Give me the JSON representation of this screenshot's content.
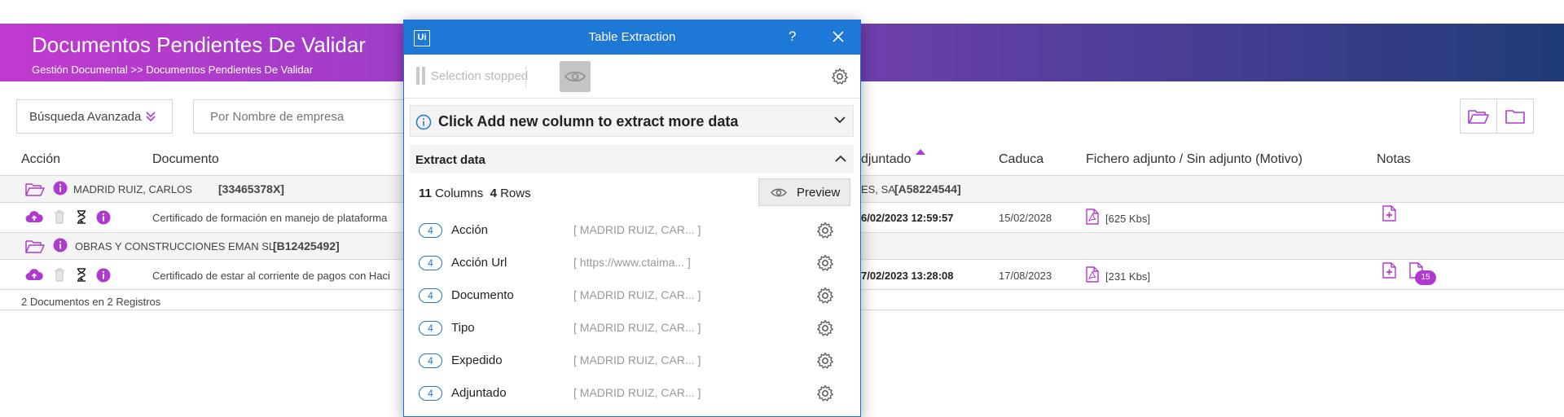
{
  "header": {
    "title": "Documentos Pendientes De Validar",
    "breadcrumb": "Gestión Documental >> Documentos Pendientes De Validar"
  },
  "search": {
    "advanced_label": "Búsqueda Avanzada",
    "company_placeholder": "Por Nombre de empresa"
  },
  "table": {
    "columns": {
      "accion": "Acción",
      "documento": "Documento",
      "adjuntado": "djuntado",
      "caduca": "Caduca",
      "fichero": "Fichero adjunto / Sin adjunto (Motivo)",
      "notas": "Notas"
    },
    "groups": [
      {
        "name": "MADRID RUIZ, CARLOS",
        "id": "[33465378X]",
        "right_name": "ES, SA",
        "right_id": "[A58224544]",
        "doc": "Certificado de formación en manejo de plataforma",
        "adjuntado": "6/02/2023 12:59:57",
        "caduca": "15/02/2028",
        "size": "[625 Kbs]"
      },
      {
        "name": "OBRAS Y CONSTRUCCIONES EMAN SL",
        "id": "[B12425492]",
        "doc": "Certificado de estar al corriente de pagos con Haci",
        "adjuntado": "7/02/2023 13:28:08",
        "caduca": "17/08/2023",
        "size": "[231 Kbs]",
        "notes_count": "15"
      }
    ],
    "footer": "2 Documentos en 2 Registros"
  },
  "dialog": {
    "title": "Table Extraction",
    "help": "?",
    "selection_status": "Selection stopped",
    "info_message": "Click Add new column to extract more data",
    "extract_section": "Extract data",
    "columns_count": "11",
    "columns_label": "Columns",
    "rows_count": "4",
    "rows_label": "Rows",
    "preview_label": "Preview",
    "columns": [
      {
        "count": "4",
        "name": "Acción",
        "preview": "[ MADRID RUIZ, CAR... ]"
      },
      {
        "count": "4",
        "name": "Acción Url",
        "preview": "[ https://www.ctaima... ]"
      },
      {
        "count": "4",
        "name": "Documento",
        "preview": "[ MADRID RUIZ, CAR... ]"
      },
      {
        "count": "4",
        "name": "Tipo",
        "preview": "[ MADRID RUIZ, CAR... ]"
      },
      {
        "count": "4",
        "name": "Expedido",
        "preview": "[ MADRID RUIZ, CAR... ]"
      },
      {
        "count": "4",
        "name": "Adjuntado",
        "preview": "[ MADRID RUIZ, CAR... ]"
      }
    ]
  },
  "colors": {
    "accent": "#b03ad0",
    "dialog_blue": "#1d78d6"
  },
  "icons": [
    "folder-open-icon",
    "info-icon",
    "upload-icon",
    "trash-icon",
    "hourglass-icon",
    "pdf-icon",
    "add-note-icon",
    "notes-icon",
    "gear-icon",
    "eye-icon",
    "close-icon",
    "chevron-down-icon",
    "chevron-up-icon"
  ]
}
